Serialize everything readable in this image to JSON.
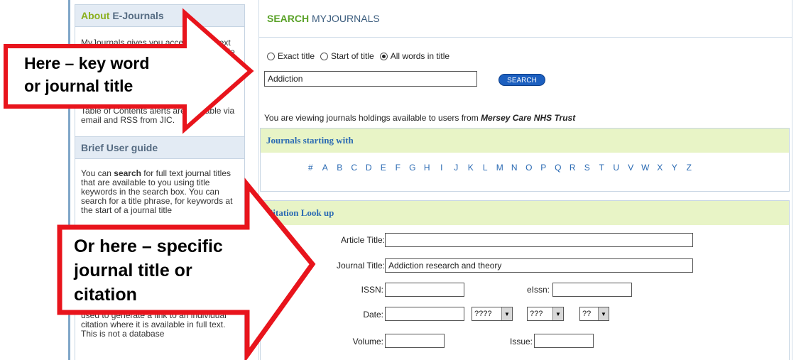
{
  "sidebar": {
    "about_title_green": "About",
    "about_title_rest": "E-Journals",
    "about_text": "MyJournals gives you access to full text electronic journals and e-books available to you and details at the point of use; details of print journals held in your local health library.",
    "alerts_text": "Table of Contents alerts are available via email and RSS from JIC.",
    "guide_title": "Brief User guide",
    "guide_text_pre": "You can ",
    "guide_text_bold": "search",
    "guide_text_post": " for full text journal titles that are available to you using title keywords in the search box. You can search for a title phrase, for keywords at the start of a journal title",
    "guide_text_bottom": "used to generate a link to an individual citation where it is available in full text. This is not a database"
  },
  "main": {
    "title_green": "SEARCH",
    "title_blue": "MYJOURNALS",
    "radios": [
      {
        "label": "Exact title",
        "selected": false
      },
      {
        "label": "Start of title",
        "selected": false
      },
      {
        "label": "All words in title",
        "selected": true
      }
    ],
    "search_value": "Addiction",
    "search_button": "SEARCH",
    "holdings_pre": "You are viewing journals holdings available to users from ",
    "holdings_org": "Mersey Care NHS Trust",
    "journals_head": "Journals starting with",
    "alphabet": [
      "#",
      "A",
      "B",
      "C",
      "D",
      "E",
      "F",
      "G",
      "H",
      "I",
      "J",
      "K",
      "L",
      "M",
      "N",
      "O",
      "P",
      "Q",
      "R",
      "S",
      "T",
      "U",
      "V",
      "W",
      "X",
      "Y",
      "Z"
    ],
    "citation_head": "Citation Look up",
    "citation": {
      "article_title_label": "Article Title:",
      "article_title_value": "",
      "journal_title_label": "Journal Title:",
      "journal_title_value": "Addiction research and theory",
      "issn_label": "ISSN:",
      "eissn_label": "eIssn:",
      "date_label": "Date:",
      "year_sel": "????",
      "month_sel": "???",
      "day_sel": "??",
      "volume_label": "Volume:",
      "issue_label": "Issue:"
    }
  },
  "callouts": {
    "top": "Here – key word or journal title",
    "top_line1": "Here – key word",
    "top_line2": "or journal title",
    "bottom_line1": "Or here – specific",
    "bottom_line2": "journal title or",
    "bottom_line3": "citation"
  },
  "colors": {
    "arrow_outline": "#e8141c",
    "green_title": "#5aa228",
    "link_blue": "#2a6ab3",
    "panel_head_bg": "#e8f4c6",
    "search_button": "#1c5fbf"
  }
}
